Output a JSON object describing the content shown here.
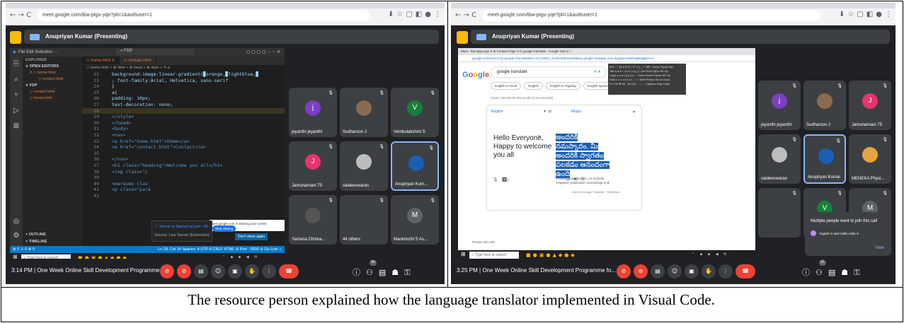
{
  "left": {
    "url": "meet.google.com/tbw-ptgu-yqe?pli=1&authuser=1",
    "presenting": "Anupriyan Kumar (Presenting)",
    "vscode": {
      "menu": "File  Edit  Selection  ···",
      "search": "FDP",
      "explorer": "EXPLORER",
      "open_editors": "OPEN EDITORS",
      "files_open": [
        "X  ◇ home.html",
        "◇ contact.html"
      ],
      "folder": "FDP",
      "files": [
        "◇ contact.html",
        "◇ home.html"
      ],
      "outline": "OUTLINE",
      "timeline": "TIMELINE",
      "tabs": [
        "◇ home.html  X",
        "◇ contact.html"
      ],
      "breadcrumb": "◇ home.html > ⊗ html > ⊗ head > ⊗ style > ✎ a",
      "code": [
        {
          "n": "22",
          "t": "          background-image:linear-gradient(▉orange,▉lightblue,▉"
        },
        {
          "n": "23",
          "t": "        ; font-family:Arial, Helvetica, sans-serif"
        },
        {
          "n": "24",
          "t": "        }"
        },
        {
          "n": "25",
          "t": "        a{"
        },
        {
          "n": "26",
          "t": "          padding: 10px;"
        },
        {
          "n": "27",
          "t": "          text-decoration: none;"
        },
        {
          "n": "28",
          "t": ""
        },
        {
          "n": "29",
          "t": "      </style>"
        },
        {
          "n": "30",
          "t": "    </head>"
        },
        {
          "n": "31",
          "t": "    <body>"
        },
        {
          "n": "32",
          "t": "      <nav>"
        },
        {
          "n": "33",
          "t": "        <a href=\"home.html\">Home</a>"
        },
        {
          "n": "34",
          "t": "        <a href=\"contact.html\">Contact</a>"
        },
        {
          "n": "35",
          "t": ""
        },
        {
          "n": "36",
          "t": "      </nav>"
        },
        {
          "n": "37",
          "t": "      <h1 class=\"heading\">Welcome you all</h1>"
        },
        {
          "n": "38",
          "t": "      <img class=\"i"
        },
        {
          "n": "39",
          "t": ""
        },
        {
          "n": "40",
          "t": "      <marquee clas"
        },
        {
          "n": "41",
          "t": "      <p class=\"para"
        },
        {
          "n": "42",
          "t": ""
        }
      ],
      "status_left": "⊗ 0 ⚠ 0   ⊛ 0",
      "status_right": "Ln 28, Col 14   Spaces: 4   UTF-8   CRLF   HTML   ⊘ Port : 5500   ⊘ Go Live   ♫",
      "toast_text": "Server is Started at port : 55",
      "toast_source": "Source: Live Server (Extension)",
      "toast_button": "Don't show again",
      "share_text": "meet.google.com is sharing your screen",
      "share_button": "Stop sharing",
      "share_hide": "Hide"
    },
    "search_placeholder": "Type here to search",
    "tiles": [
      {
        "name": "jeyanthi jeyanthi",
        "initial": "j",
        "color": "#7b3fbf"
      },
      {
        "name": "Sudharson J",
        "initial": "",
        "color": "#8a6a50"
      },
      {
        "name": "Vembulakshmi S",
        "initial": "V",
        "color": "#188038"
      },
      {
        "name": "Jamunarnani 75",
        "initial": "J",
        "color": "#e8336d"
      },
      {
        "name": "vaideeswaran",
        "initial": "",
        "color": "#bdbdbd"
      },
      {
        "name": "Anupriyan Kum...",
        "initial": "",
        "color": "#1a5fb4"
      },
      {
        "name": "Yamuna Chinna...",
        "initial": "",
        "color": "#555"
      },
      {
        "name": "44 others",
        "initial": "",
        "color": "#3c4043"
      },
      {
        "name": "Manimozhi S As...",
        "initial": "M",
        "color": "#5f6368"
      }
    ],
    "time": "3:14 PM  |  One Week Online Skill Development Programme fo...",
    "badge": "56"
  },
  "right": {
    "url": "meet.google.com/tbw-ptgu-yqe?pli=1&authuser=1",
    "presenting": "Anupriyan Kumar (Presenting)",
    "translate": {
      "tabs": "Meet - tbw-ptgu-yqe   X   ⊕ Contact Page   X   G google translate - Google Sea  X   +",
      "url": "google.com/search?q=google+translate&rlz=1C1GEEA_enIN1008IN1008&oq=google+tran&gs_lcrp=EgZjaHJvbWUqBwgBEAAY",
      "logo": "Google",
      "query": "google translate",
      "chips": [
        "English to Hindi",
        "English",
        "English to Tagalog",
        "English spanish",
        "English to French"
      ],
      "results": "About 2,89,00,00,000 results (0.34 seconds)",
      "src_lang": "English",
      "tgt_lang": "Telugu",
      "source": "Hello Everyone, Happy to welcome you all",
      "target": "అందరికీ నమస్కారం, మీ అందరికీ స్వాగతం పలకడం ఆనందంగా ఉంది",
      "translit": "Andarikī namaskāram, mī andarikī svāgataṁ palakaḍaṁ ānandaṅgā undi",
      "feedback": "Open in Google Translate  ·  Feedback",
      "footer": "People also ask",
      "kbd_cols": [
        "Home",
        "PgUp",
        "Nav",
        "End",
        "PgDn",
        "Mv Up",
        "Insert",
        "Pause",
        "Mv Dn",
        "PrtScn",
        "ScrLk",
        "Dock",
        "Options",
        "Help",
        "Fade"
      ]
    },
    "tiles": [
      {
        "name": "jeyanthi jeyanthi",
        "initial": "j",
        "color": "#7b3fbf"
      },
      {
        "name": "Sudharson J",
        "initial": "",
        "color": "#8a6a50"
      },
      {
        "name": "Jamunarnani 75",
        "initial": "J",
        "color": "#e8336d"
      },
      {
        "name": "vaideeswaran",
        "initial": "",
        "color": "#bdbdbd"
      },
      {
        "name": "Anupriyan Kumar",
        "initial": "",
        "color": "#1a5fb4"
      },
      {
        "name": "MENEKA Physi...",
        "initial": "",
        "color": "#e8a33d"
      },
      {
        "name": "",
        "initial": "",
        "color": "#3c4043"
      },
      {
        "name": "Vembulakshmi S",
        "initial": "V",
        "color": "#188038"
      },
      {
        "name": "",
        "initial": "M",
        "color": "#5f6368"
      }
    ],
    "notif_title": "Multiple people want to join this call",
    "notif_names": "Yogesh S and Catlin Anila S",
    "notif_view": "View",
    "time": "3:25 PM  |  One Week Online Skill Development Programme fo...",
    "badge": "61"
  },
  "caption": "The resource person explained how the language translator implemented in Visual Code.",
  "colors": {
    "meet_bg": "#202124",
    "end_call": "#ea4335",
    "vs_status": "#007acc",
    "accent": "#8ab4f8"
  }
}
